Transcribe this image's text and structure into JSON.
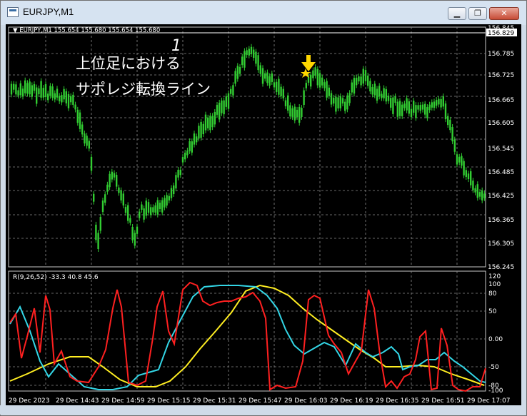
{
  "window": {
    "title": "EURJPY,M1",
    "minimize_label": "▁",
    "maximize_label": "❐",
    "close_label": "✕"
  },
  "main_panel": {
    "info_label": "▼ EURJPY,M1  155.654 155.680 155.654 155.680",
    "current_price": "156.829",
    "price_ticks": [
      "156.845",
      "156.785",
      "156.725",
      "156.665",
      "156.605",
      "156.545",
      "156.485",
      "156.425",
      "156.365",
      "156.305",
      "156.245"
    ],
    "annotation_line1": "上位足におけるサポレジ転換ライン",
    "annotation_number": "1",
    "arrow_icon": "down-arrow-icon",
    "star_icon": "star-icon",
    "colors": {
      "candle": "#32cd32",
      "annotation_arrow": "#ffd700",
      "grid": "#8a8a8a"
    }
  },
  "indicator_panel": {
    "info_label": "R(9,26,52) -33.3 40.8 45.6",
    "scale_ticks": [
      "120",
      "100",
      "80",
      "50",
      "0.00",
      "-50",
      "-80",
      "-100"
    ],
    "colors": {
      "fast": "#ff2020",
      "mid": "#33d6e6",
      "slow": "#ffee22"
    }
  },
  "time_axis": {
    "labels": [
      "29 Dec 2023",
      "29 Dec 14:43",
      "29 Dec 14:59",
      "29 Dec 15:15",
      "29 Dec 15:31",
      "29 Dec 15:47",
      "29 Dec 16:03",
      "29 Dec 16:19",
      "29 Dec 16:35",
      "29 Dec 16:51",
      "29 Dec 17:07"
    ]
  }
}
